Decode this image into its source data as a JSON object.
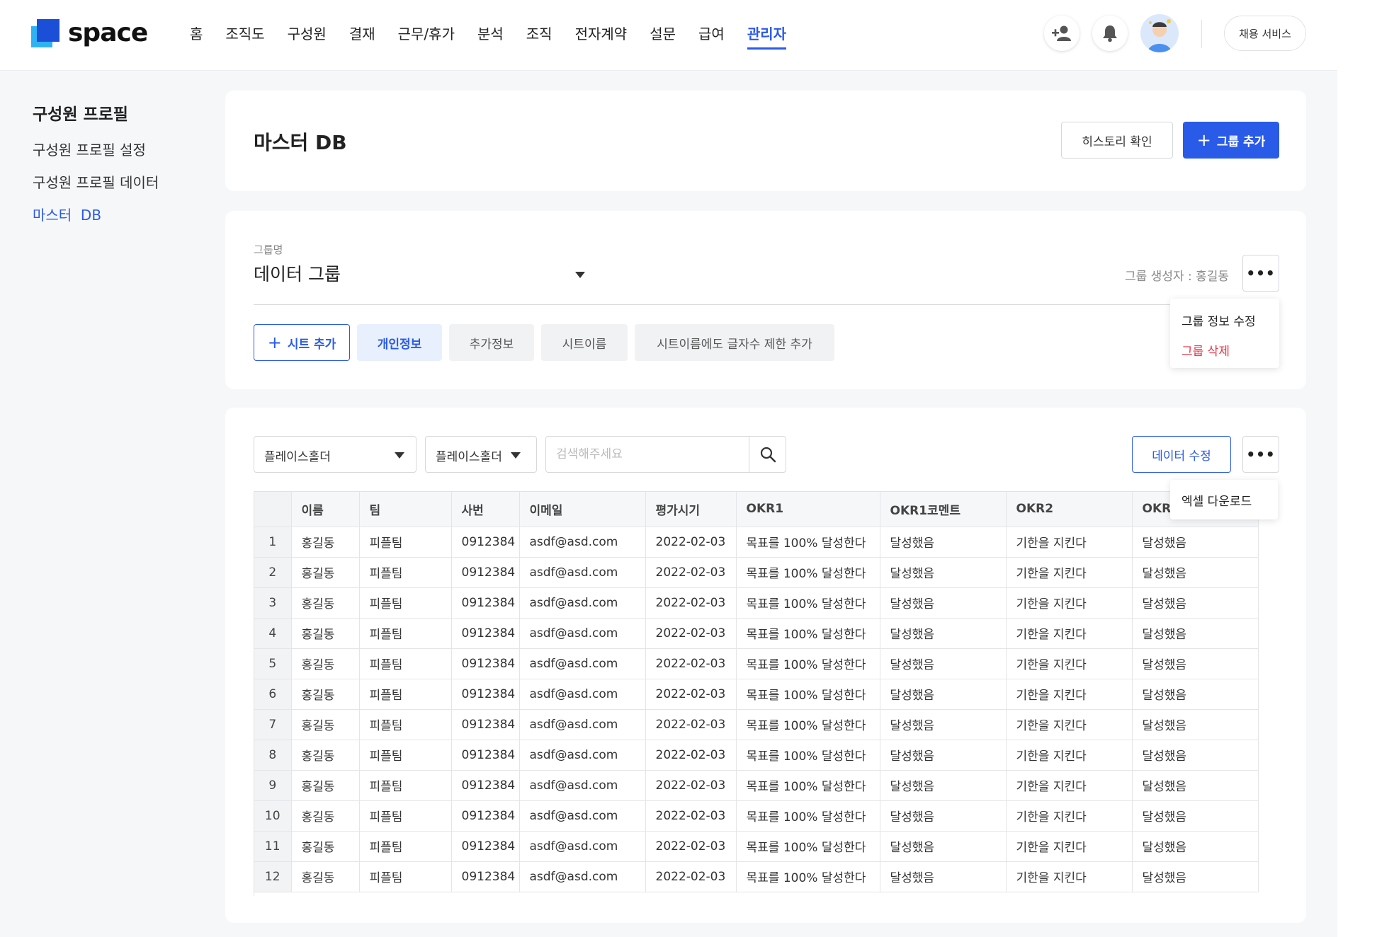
{
  "header": {
    "logo_text": "space",
    "nav": [
      "홈",
      "조직도",
      "구성원",
      "결재",
      "근무/휴가",
      "분석",
      "조직",
      "전자계약",
      "설문",
      "급여",
      "관리자"
    ],
    "active_nav": "관리자",
    "hire_label": "채용 서비스"
  },
  "sidebar": {
    "title": "구성원 프로필",
    "items": [
      {
        "label": "구성원 프로필 설정"
      },
      {
        "label": "구성원 프로필 데이터"
      },
      {
        "label": "마스터  DB"
      }
    ],
    "active": "마스터  DB"
  },
  "page": {
    "title": "마스터 DB",
    "history_label": "히스토리 확인",
    "add_group_label": "그룹 추가"
  },
  "group": {
    "label": "그룹명",
    "selected": "데이터 그룹",
    "creator": "그룹 생성자 : 홍길동",
    "menu": [
      "그룹 정보 수정",
      "그룹 삭제"
    ]
  },
  "tabs": {
    "add_label": "시트 추가",
    "items": [
      "개인정보",
      "추가정보",
      "시트이름",
      "시트이름에도 글자수 제한 추가"
    ],
    "selected": "개인정보"
  },
  "toolbar": {
    "filter1": "플레이스홀더",
    "filter2": "플레이스홀더",
    "search_placeholder": "검색해주세요",
    "edit_label": "데이터 수정",
    "more_menu": [
      "엑셀 다운로드"
    ]
  },
  "table": {
    "columns": [
      "이름",
      "팀",
      "사번",
      "이메일",
      "평가시기",
      "OKR1",
      "OKR1코멘트",
      "OKR2",
      "OKR2"
    ],
    "rows": [
      [
        "1",
        "홍길동",
        "피플팀",
        "0912384",
        "asdf@asd.com",
        "2022-02-03",
        "목표를 100% 달성한다",
        "달성했음",
        "기한을 지킨다",
        "달성했음"
      ],
      [
        "2",
        "홍길동",
        "피플팀",
        "0912384",
        "asdf@asd.com",
        "2022-02-03",
        "목표를 100% 달성한다",
        "달성했음",
        "기한을 지킨다",
        "달성했음"
      ],
      [
        "3",
        "홍길동",
        "피플팀",
        "0912384",
        "asdf@asd.com",
        "2022-02-03",
        "목표를 100% 달성한다",
        "달성했음",
        "기한을 지킨다",
        "달성했음"
      ],
      [
        "4",
        "홍길동",
        "피플팀",
        "0912384",
        "asdf@asd.com",
        "2022-02-03",
        "목표를 100% 달성한다",
        "달성했음",
        "기한을 지킨다",
        "달성했음"
      ],
      [
        "5",
        "홍길동",
        "피플팀",
        "0912384",
        "asdf@asd.com",
        "2022-02-03",
        "목표를 100% 달성한다",
        "달성했음",
        "기한을 지킨다",
        "달성했음"
      ],
      [
        "6",
        "홍길동",
        "피플팀",
        "0912384",
        "asdf@asd.com",
        "2022-02-03",
        "목표를 100% 달성한다",
        "달성했음",
        "기한을 지킨다",
        "달성했음"
      ],
      [
        "7",
        "홍길동",
        "피플팀",
        "0912384",
        "asdf@asd.com",
        "2022-02-03",
        "목표를 100% 달성한다",
        "달성했음",
        "기한을 지킨다",
        "달성했음"
      ],
      [
        "8",
        "홍길동",
        "피플팀",
        "0912384",
        "asdf@asd.com",
        "2022-02-03",
        "목표를 100% 달성한다",
        "달성했음",
        "기한을 지킨다",
        "달성했음"
      ],
      [
        "9",
        "홍길동",
        "피플팀",
        "0912384",
        "asdf@asd.com",
        "2022-02-03",
        "목표를 100% 달성한다",
        "달성했음",
        "기한을 지킨다",
        "달성했음"
      ],
      [
        "10",
        "홍길동",
        "피플팀",
        "0912384",
        "asdf@asd.com",
        "2022-02-03",
        "목표를 100% 달성한다",
        "달성했음",
        "기한을 지킨다",
        "달성했음"
      ],
      [
        "11",
        "홍길동",
        "피플팀",
        "0912384",
        "asdf@asd.com",
        "2022-02-03",
        "목표를 100% 달성한다",
        "달성했음",
        "기한을 지킨다",
        "달성했음"
      ],
      [
        "12",
        "홍길동",
        "피플팀",
        "0912384",
        "asdf@asd.com",
        "2022-02-03",
        "목표를 100% 달성한다",
        "달성했음",
        "기한을 지킨다",
        "달성했음"
      ]
    ]
  },
  "colors": {
    "accent": "#2a5ae8",
    "danger": "#e8374a",
    "tab_selected_bg": "#e8f0fd"
  },
  "icons": {
    "add_user": "add-user-icon",
    "bell": "bell-icon",
    "search": "search-icon",
    "more": "more-icon",
    "caret": "caret-down-icon"
  }
}
